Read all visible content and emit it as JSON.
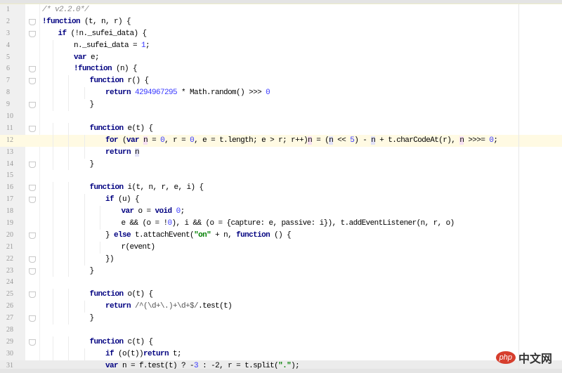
{
  "editor": {
    "current_line": 12,
    "lines": [
      {
        "num": "1",
        "indent": 0,
        "fold": false,
        "tokens": [
          [
            "c",
            "/* v2.2.0*/"
          ]
        ]
      },
      {
        "num": "2",
        "indent": 0,
        "fold": true,
        "tokens": [
          [
            "k",
            "!function"
          ],
          [
            "p",
            " (t, n, r) {"
          ]
        ]
      },
      {
        "num": "3",
        "indent": 1,
        "fold": true,
        "tokens": [
          [
            "k",
            "if"
          ],
          [
            "p",
            " (!n._sufei_data) {"
          ]
        ]
      },
      {
        "num": "4",
        "indent": 2,
        "fold": false,
        "tokens": [
          [
            "p",
            "n._sufei_data = "
          ],
          [
            "n",
            "1"
          ],
          [
            "p",
            ";"
          ]
        ]
      },
      {
        "num": "5",
        "indent": 2,
        "fold": false,
        "tokens": [
          [
            "k",
            "var"
          ],
          [
            "p",
            " e;"
          ]
        ]
      },
      {
        "num": "6",
        "indent": 2,
        "fold": true,
        "tokens": [
          [
            "k",
            "!function"
          ],
          [
            "p",
            " (n) {"
          ]
        ]
      },
      {
        "num": "7",
        "indent": 3,
        "fold": true,
        "tokens": [
          [
            "k",
            "function"
          ],
          [
            "p",
            " r() {"
          ]
        ]
      },
      {
        "num": "8",
        "indent": 4,
        "fold": false,
        "tokens": [
          [
            "k",
            "return"
          ],
          [
            "p",
            " "
          ],
          [
            "n",
            "4294967295"
          ],
          [
            "p",
            " * Math.random() >>> "
          ],
          [
            "n",
            "0"
          ]
        ]
      },
      {
        "num": "9",
        "indent": 3,
        "fold": true,
        "tokens": [
          [
            "p",
            "}"
          ]
        ]
      },
      {
        "num": "10",
        "indent": 0,
        "fold": false,
        "tokens": []
      },
      {
        "num": "11",
        "indent": 3,
        "fold": true,
        "tokens": [
          [
            "k",
            "function"
          ],
          [
            "p",
            " e(t) {"
          ]
        ]
      },
      {
        "num": "12",
        "indent": 4,
        "fold": false,
        "tokens": [
          [
            "k",
            "for"
          ],
          [
            "p",
            " ("
          ],
          [
            "k",
            "var"
          ],
          [
            "p",
            " "
          ],
          [
            "h",
            "n"
          ],
          [
            "p",
            " = "
          ],
          [
            "n",
            "0"
          ],
          [
            "p",
            ", r = "
          ],
          [
            "n",
            "0"
          ],
          [
            "p",
            ", e = t.length; e > r; r++)"
          ],
          [
            "h",
            "n"
          ],
          [
            "p",
            " = ("
          ],
          [
            "hb",
            "n"
          ],
          [
            "p",
            " << "
          ],
          [
            "n",
            "5"
          ],
          [
            "p",
            ") - "
          ],
          [
            "hb",
            "n"
          ],
          [
            "p",
            " + t.charCodeAt(r), "
          ],
          [
            "h",
            "n"
          ],
          [
            "p",
            " >>>= "
          ],
          [
            "n",
            "0"
          ],
          [
            "p",
            ";"
          ]
        ]
      },
      {
        "num": "13",
        "indent": 4,
        "fold": false,
        "tokens": [
          [
            "k",
            "return"
          ],
          [
            "p",
            " "
          ],
          [
            "hb",
            "n"
          ]
        ]
      },
      {
        "num": "14",
        "indent": 3,
        "fold": true,
        "tokens": [
          [
            "p",
            "}"
          ]
        ]
      },
      {
        "num": "15",
        "indent": 0,
        "fold": false,
        "tokens": []
      },
      {
        "num": "16",
        "indent": 3,
        "fold": true,
        "tokens": [
          [
            "k",
            "function"
          ],
          [
            "p",
            " i(t, n, r, e, i) {"
          ]
        ]
      },
      {
        "num": "17",
        "indent": 4,
        "fold": true,
        "tokens": [
          [
            "k",
            "if"
          ],
          [
            "p",
            " (u) {"
          ]
        ]
      },
      {
        "num": "18",
        "indent": 5,
        "fold": false,
        "tokens": [
          [
            "k",
            "var"
          ],
          [
            "p",
            " o = "
          ],
          [
            "k",
            "void"
          ],
          [
            "p",
            " "
          ],
          [
            "n",
            "0"
          ],
          [
            "p",
            ";"
          ]
        ]
      },
      {
        "num": "19",
        "indent": 5,
        "fold": false,
        "tokens": [
          [
            "p",
            "e && (o = !"
          ],
          [
            "n",
            "0"
          ],
          [
            "p",
            "), i && (o = {capture: e, passive: i}), t.addEventListener(n, r, o)"
          ]
        ]
      },
      {
        "num": "20",
        "indent": 4,
        "fold": true,
        "tokens": [
          [
            "p",
            "} "
          ],
          [
            "k",
            "else"
          ],
          [
            "p",
            " t.attachEvent("
          ],
          [
            "s",
            "\"on\""
          ],
          [
            "p",
            " + n, "
          ],
          [
            "k",
            "function"
          ],
          [
            "p",
            " () {"
          ]
        ]
      },
      {
        "num": "21",
        "indent": 5,
        "fold": false,
        "tokens": [
          [
            "p",
            "r(event)"
          ]
        ]
      },
      {
        "num": "22",
        "indent": 4,
        "fold": true,
        "tokens": [
          [
            "p",
            "})"
          ]
        ]
      },
      {
        "num": "23",
        "indent": 3,
        "fold": true,
        "tokens": [
          [
            "p",
            "}"
          ]
        ]
      },
      {
        "num": "24",
        "indent": 0,
        "fold": false,
        "tokens": []
      },
      {
        "num": "25",
        "indent": 3,
        "fold": true,
        "tokens": [
          [
            "k",
            "function"
          ],
          [
            "p",
            " o(t) {"
          ]
        ]
      },
      {
        "num": "26",
        "indent": 4,
        "fold": false,
        "tokens": [
          [
            "k",
            "return"
          ],
          [
            "p",
            " "
          ],
          [
            "r",
            "/^(\\d+\\.)+\\d+$/"
          ],
          [
            "p",
            ".test(t)"
          ]
        ]
      },
      {
        "num": "27",
        "indent": 3,
        "fold": true,
        "tokens": [
          [
            "p",
            "}"
          ]
        ]
      },
      {
        "num": "28",
        "indent": 0,
        "fold": false,
        "tokens": []
      },
      {
        "num": "29",
        "indent": 3,
        "fold": true,
        "tokens": [
          [
            "k",
            "function"
          ],
          [
            "p",
            " c(t) {"
          ]
        ]
      },
      {
        "num": "30",
        "indent": 4,
        "fold": false,
        "tokens": [
          [
            "k",
            "if"
          ],
          [
            "p",
            " (o(t))"
          ],
          [
            "k",
            "return"
          ],
          [
            "p",
            " t;"
          ]
        ]
      },
      {
        "num": "31",
        "indent": 4,
        "fold": false,
        "tokens": [
          [
            "k",
            "var"
          ],
          [
            "p",
            " n = f.test(t) ? -"
          ],
          [
            "n",
            "3"
          ],
          [
            "p",
            " : -2, r = t.split("
          ],
          [
            "s",
            "\".\""
          ],
          [
            "p",
            ");"
          ]
        ]
      }
    ]
  },
  "watermark": {
    "logo": "php",
    "text": "中文网"
  }
}
